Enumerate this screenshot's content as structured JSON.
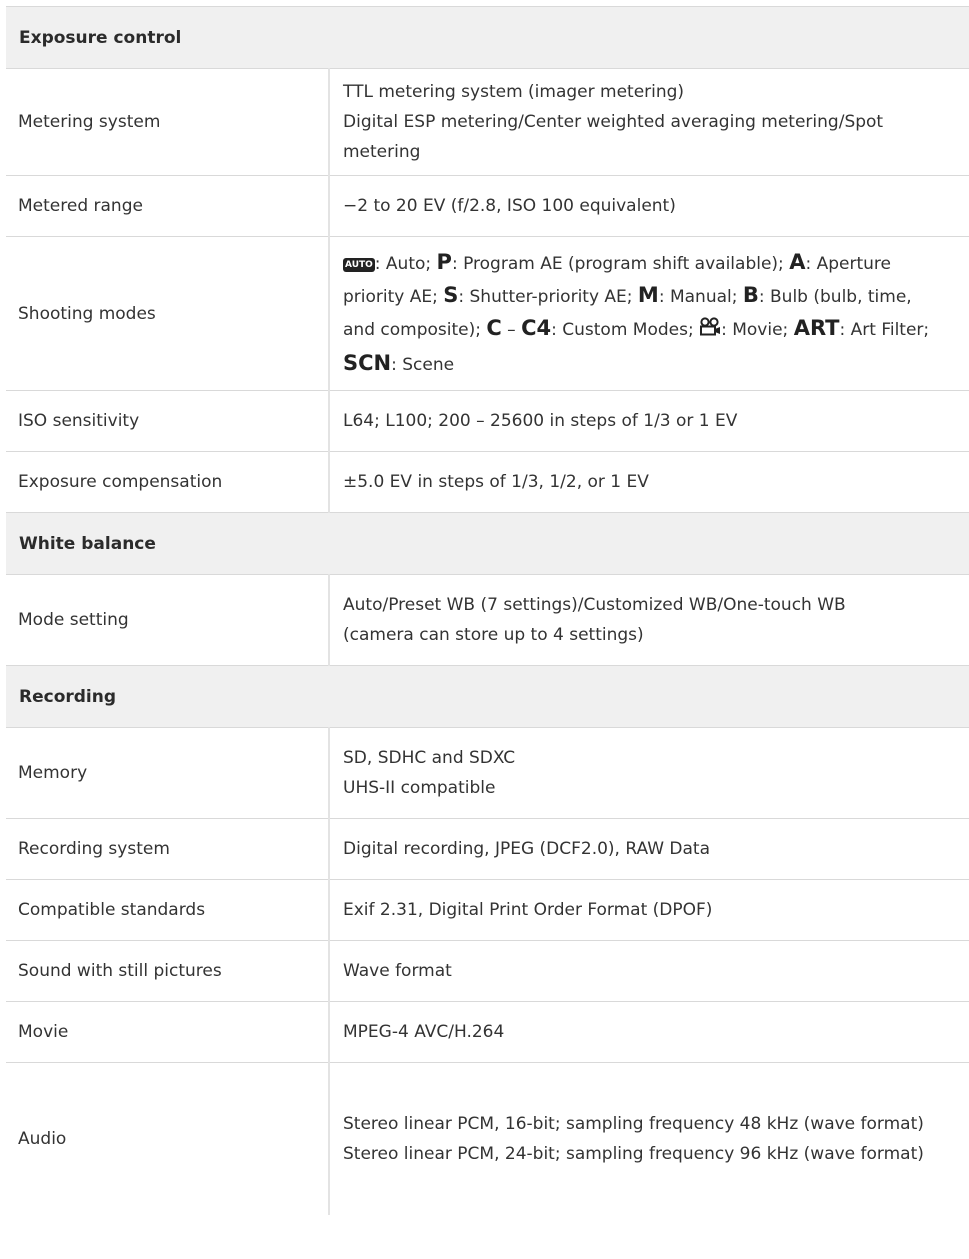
{
  "sections": {
    "exposure": "Exposure control",
    "white_balance": "White balance",
    "recording": "Recording"
  },
  "rows": {
    "metering_system": {
      "label": "Metering system",
      "line1": "TTL metering system (imager metering)",
      "line2": "Digital ESP metering/Center weighted averaging metering/Spot metering"
    },
    "metered_range": {
      "label": "Metered range",
      "value": "−2 to 20 EV (f/2.8, ISO 100 equivalent)"
    },
    "shooting_modes": {
      "label": "Shooting modes",
      "auto_icon_text": "AUTO",
      "auto_desc": ": Auto; ",
      "p_sym": "P",
      "p_desc": ": Program AE (program shift available); ",
      "a_sym": "A",
      "a_desc": ": Aperture priority AE; ",
      "s_sym": "S",
      "s_desc": ": Shutter-priority AE; ",
      "m_sym": "M",
      "m_desc": ": Manual; ",
      "b_sym": "B",
      "b_desc": ": Bulb (bulb, time, and composite); ",
      "c_sym": "C",
      "c_dash": " – ",
      "c4_sym": "C4",
      "c_desc": ": Custom Modes; ",
      "movie_desc": ": Movie; ",
      "art_sym": "ART",
      "art_desc": ": Art Filter; ",
      "scn_sym": "SCN",
      "scn_desc": ": Scene"
    },
    "iso": {
      "label": "ISO sensitivity",
      "value": "L64; L100; 200 – 25600 in steps of 1/3 or 1 EV"
    },
    "exposure_comp": {
      "label": "Exposure compensation",
      "value": "±5.0 EV in steps of 1/3, 1/2, or 1 EV"
    },
    "mode_setting": {
      "label": "Mode setting",
      "line1": "Auto/Preset WB (7 settings)/Customized WB/One-touch WB",
      "line2": "(camera can store up to 4 settings)"
    },
    "memory": {
      "label": "Memory",
      "line1": "SD, SDHC and SDXC",
      "line2": "UHS-II compatible"
    },
    "recording_system": {
      "label": "Recording system",
      "value": "Digital recording, JPEG (DCF2.0), RAW Data"
    },
    "compatible_standards": {
      "label": "Compatible standards",
      "value": "Exif 2.31, Digital Print Order Format (DPOF)"
    },
    "sound_stills": {
      "label": "Sound with still pictures",
      "value": "Wave format"
    },
    "movie": {
      "label": "Movie",
      "value": "MPEG-4 AVC/H.264"
    },
    "audio": {
      "label": "Audio",
      "line1": "Stereo linear PCM, 16-bit; sampling frequency 48 kHz (wave format)",
      "line2": "Stereo linear PCM, 24-bit; sampling frequency 96 kHz (wave format)"
    }
  },
  "icons": {
    "auto": "auto-mode-icon",
    "movie": "movie-mode-icon"
  }
}
